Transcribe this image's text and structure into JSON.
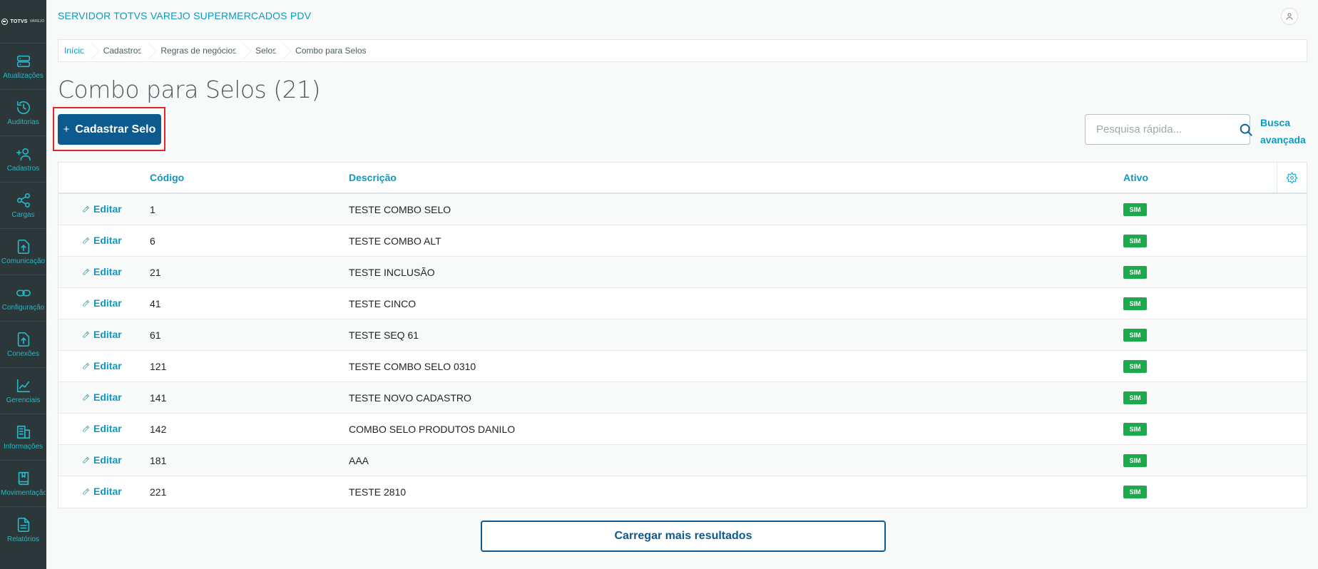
{
  "brand": {
    "logo_text": "TOTVS",
    "logo_sub": "VAREJO"
  },
  "header": {
    "title": "SERVIDOR TOTVS VAREJO SUPERMERCADOS PDV"
  },
  "sidebar": {
    "items": [
      {
        "label": "Atualizações",
        "icon": "server-icon"
      },
      {
        "label": "Auditorias",
        "icon": "history-icon"
      },
      {
        "label": "Cadastros",
        "icon": "add-user-icon"
      },
      {
        "label": "Cargas",
        "icon": "share-icon"
      },
      {
        "label": "Comunicação",
        "icon": "upload-file-icon"
      },
      {
        "label": "Configuração",
        "icon": "link-icon"
      },
      {
        "label": "Conexões",
        "icon": "upload-file-icon"
      },
      {
        "label": "Gerenciais",
        "icon": "chart-icon"
      },
      {
        "label": "Informações",
        "icon": "building-icon"
      },
      {
        "label": "Movimentação",
        "icon": "book-icon"
      },
      {
        "label": "Relatórios",
        "icon": "document-icon"
      }
    ]
  },
  "breadcrumb": [
    "Início",
    "Cadastros",
    "Regras de negócios",
    "Selos",
    "Combo para Selos"
  ],
  "page": {
    "title": "Combo para Selos (21)"
  },
  "actions": {
    "primary_label": "Cadastrar Selo",
    "primary_plus": "+"
  },
  "search": {
    "placeholder": "Pesquisa rápida...",
    "advanced_label": "Busca avançada"
  },
  "table": {
    "headers": {
      "codigo": "Código",
      "descricao": "Descrição",
      "ativo": "Ativo"
    },
    "edit_label": "Editar",
    "rows": [
      {
        "codigo": "1",
        "descricao": "TESTE COMBO SELO",
        "ativo": "SIM"
      },
      {
        "codigo": "6",
        "descricao": "TESTE COMBO ALT",
        "ativo": "SIM"
      },
      {
        "codigo": "21",
        "descricao": "TESTE INCLUSÃO",
        "ativo": "SIM"
      },
      {
        "codigo": "41",
        "descricao": "TESTE CINCO",
        "ativo": "SIM"
      },
      {
        "codigo": "61",
        "descricao": "TESTE SEQ 61",
        "ativo": "SIM"
      },
      {
        "codigo": "121",
        "descricao": "TESTE COMBO SELO 0310",
        "ativo": "SIM"
      },
      {
        "codigo": "141",
        "descricao": "TESTE NOVO CADASTRO",
        "ativo": "SIM"
      },
      {
        "codigo": "142",
        "descricao": "COMBO SELO PRODUTOS DANILO",
        "ativo": "SIM"
      },
      {
        "codigo": "181",
        "descricao": "AAA",
        "ativo": "SIM"
      },
      {
        "codigo": "221",
        "descricao": "TESTE 2810",
        "ativo": "SIM"
      }
    ]
  },
  "load_more": {
    "label": "Carregar mais resultados"
  },
  "colors": {
    "sidebar_bg": "#2c3739",
    "accent": "#0c9abe",
    "primary": "#0c5a8e",
    "success": "#1ba94c",
    "highlight": "#e3262a"
  }
}
